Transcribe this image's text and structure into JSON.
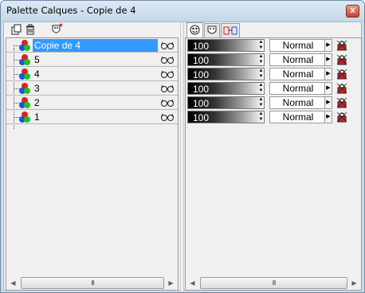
{
  "window": {
    "title": "Palette Calques - Copie de 4",
    "close_label": "x"
  },
  "left_toolbar": {
    "icons": [
      "new-layer-icon",
      "delete-layer-icon",
      "mask-icon"
    ]
  },
  "layers": [
    {
      "name": "Copie de 4",
      "selected": true
    },
    {
      "name": "5",
      "selected": false
    },
    {
      "name": "4",
      "selected": false
    },
    {
      "name": "3",
      "selected": false
    },
    {
      "name": "2",
      "selected": false
    },
    {
      "name": "1",
      "selected": false
    }
  ],
  "right_tabs": [
    "layer-properties-tab-icon",
    "mask-tab-icon",
    "link-tab-icon"
  ],
  "properties": [
    {
      "opacity": "100",
      "blend": "Normal"
    },
    {
      "opacity": "100",
      "blend": "Normal"
    },
    {
      "opacity": "100",
      "blend": "Normal"
    },
    {
      "opacity": "100",
      "blend": "Normal"
    },
    {
      "opacity": "100",
      "blend": "Normal"
    },
    {
      "opacity": "100",
      "blend": "Normal"
    }
  ],
  "scrollbar_grip": "III",
  "colors": {
    "selection": "#3399ff",
    "titlebar": "#c4d7e8",
    "close": "#c2412b"
  }
}
